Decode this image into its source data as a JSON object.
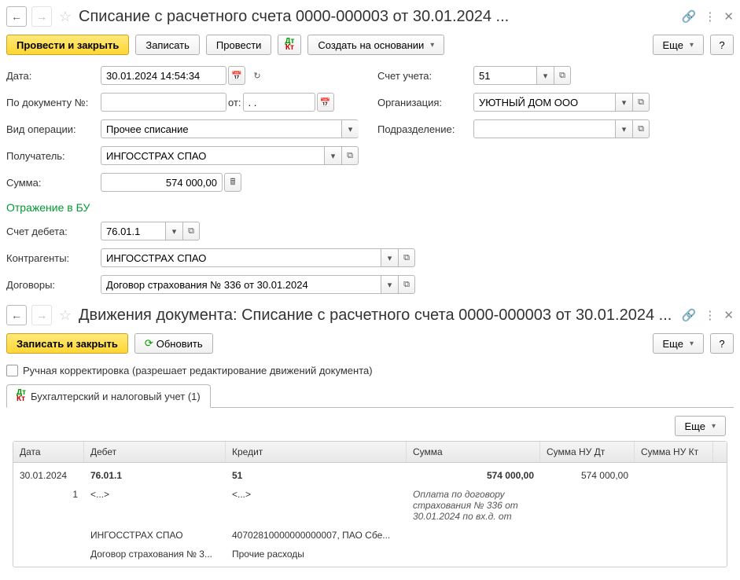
{
  "top": {
    "title": "Списание с расчетного счета 0000-000003 от 30.01.2024 ...",
    "toolbar": {
      "post_close": "Провести и закрыть",
      "save": "Записать",
      "post": "Провести",
      "create_based": "Создать на основании",
      "more": "Еще"
    },
    "labels": {
      "date": "Дата:",
      "doc_num": "По документу №:",
      "from": "от:",
      "op_type": "Вид операции:",
      "recipient": "Получатель:",
      "amount": "Сумма:",
      "account": "Счет учета:",
      "org": "Организация:",
      "subdivision": "Подразделение:"
    },
    "values": {
      "date": "30.01.2024 14:54:34",
      "doc_num": "",
      "from": ". .",
      "op_type": "Прочее списание",
      "recipient": "ИНГОССТРАХ СПАО",
      "amount": "574 000,00",
      "account": "51",
      "org": "УЮТНЫЙ ДОМ ООО",
      "subdivision": ""
    },
    "bu_section": "Отражение в БУ",
    "bu": {
      "debit_acc_label": "Счет дебета:",
      "counterparty_label": "Контрагенты:",
      "contract_label": "Договоры:",
      "debit_acc": "76.01.1",
      "counterparty": "ИНГОССТРАХ СПАО",
      "contract": "Договор страхования № 336 от 30.01.2024"
    }
  },
  "movements": {
    "title": "Движения документа: Списание с расчетного счета 0000-000003 от 30.01.2024 ...",
    "toolbar": {
      "save_close": "Записать и закрыть",
      "refresh": "Обновить",
      "more": "Еще"
    },
    "manual_edit": "Ручная корректировка (разрешает редактирование движений документа)",
    "tab_label": "Бухгалтерский и налоговый учет (1)",
    "more_btn": "Еще",
    "headers": {
      "date": "Дата",
      "debit": "Дебет",
      "credit": "Кредит",
      "sum": "Сумма",
      "sum_nu_dt": "Сумма НУ Дт",
      "sum_nu_kt": "Сумма НУ Кт"
    },
    "rows": [
      {
        "date": "30.01.2024",
        "idx": "1",
        "debit1": "76.01.1",
        "debit2": "<...>",
        "debit3": "ИНГОССТРАХ СПАО",
        "debit4": "Договор страхования № 3...",
        "credit1": "51",
        "credit2": "<...>",
        "credit3": "40702810000000000007, ПАО Сбе...",
        "credit4": "Прочие расходы",
        "sum": "574 000,00",
        "sum_note": "Оплата по договору страхования № 336 от 30.01.2024 по вх.д. от",
        "sum_nu_dt": "574 000,00",
        "sum_nu_kt": ""
      }
    ]
  }
}
